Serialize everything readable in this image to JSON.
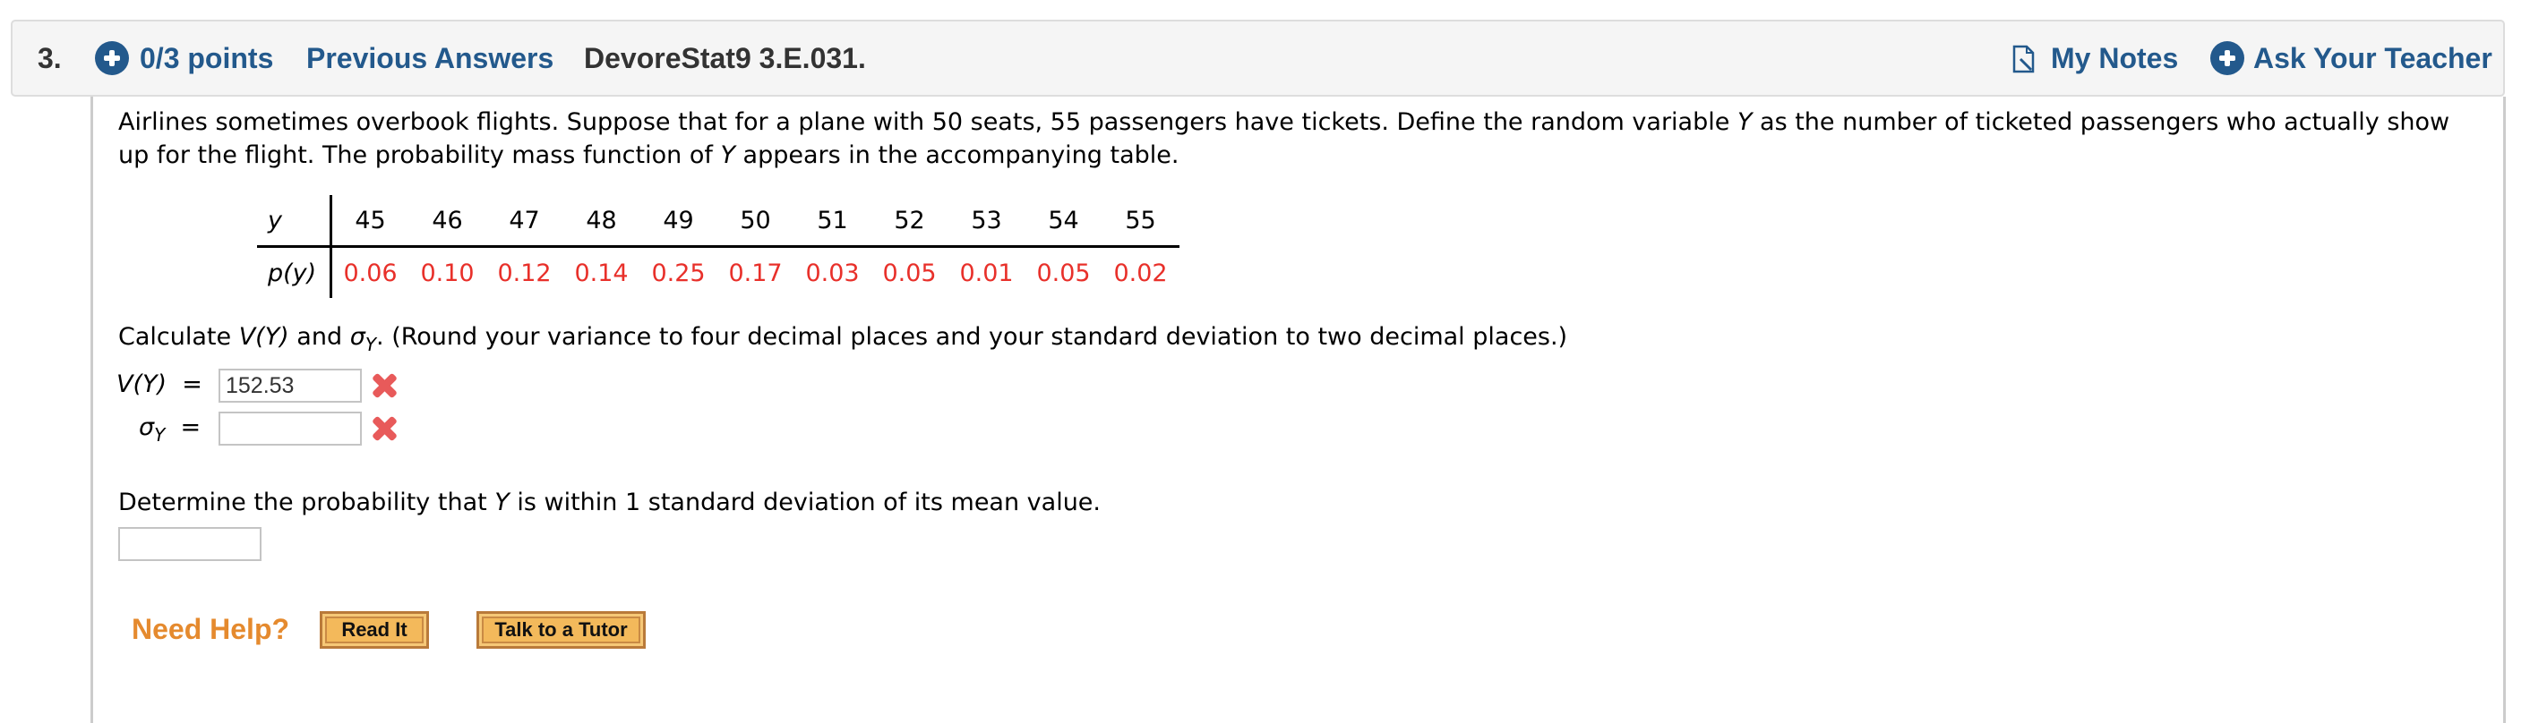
{
  "header": {
    "question_number": "3.",
    "points": "0/3 points",
    "previous_answers": "Previous Answers",
    "title": "DevoreStat9 3.E.031.",
    "my_notes": "My Notes",
    "ask_teacher": "Ask Your Teacher",
    "accent_color": "#23598c"
  },
  "question": {
    "intro_part1": "Airlines sometimes overbook flights. Suppose that for a plane with 50 seats, 55 passengers have tickets. Define the random variable ",
    "var": "Y",
    "intro_part2": " as the number of ticketed passengers who actually show up for the flight. The probability mass function of ",
    "intro_part3": " appears in the accompanying table."
  },
  "pmf_table": {
    "row_label_y": "y",
    "row_label_p": "p(y)",
    "y_values": [
      "45",
      "46",
      "47",
      "48",
      "49",
      "50",
      "51",
      "52",
      "53",
      "54",
      "55"
    ],
    "p_values": [
      "0.06",
      "0.10",
      "0.12",
      "0.14",
      "0.25",
      "0.17",
      "0.03",
      "0.05",
      "0.01",
      "0.05",
      "0.02"
    ],
    "value_color": "#e8302a"
  },
  "calc": {
    "prefix": "Calculate ",
    "vy": "V(Y)",
    "and": " and ",
    "sigma": "σ",
    "sigma_sub": "Y",
    "suffix": ". (Round your variance to four decimal places and your standard deviation to two decimal places.)",
    "variance_label": "V(Y)",
    "equals": "=",
    "variance_value": "152.53",
    "sd_value": "",
    "variance_status": "incorrect",
    "sd_status": "incorrect"
  },
  "determine": {
    "part1": "Determine the probability that ",
    "var": "Y",
    "part2": " is within 1 standard deviation of its mean value.",
    "answer_value": ""
  },
  "help": {
    "label": "Need Help?",
    "read_it": "Read It",
    "talk_tutor": "Talk to a Tutor"
  }
}
